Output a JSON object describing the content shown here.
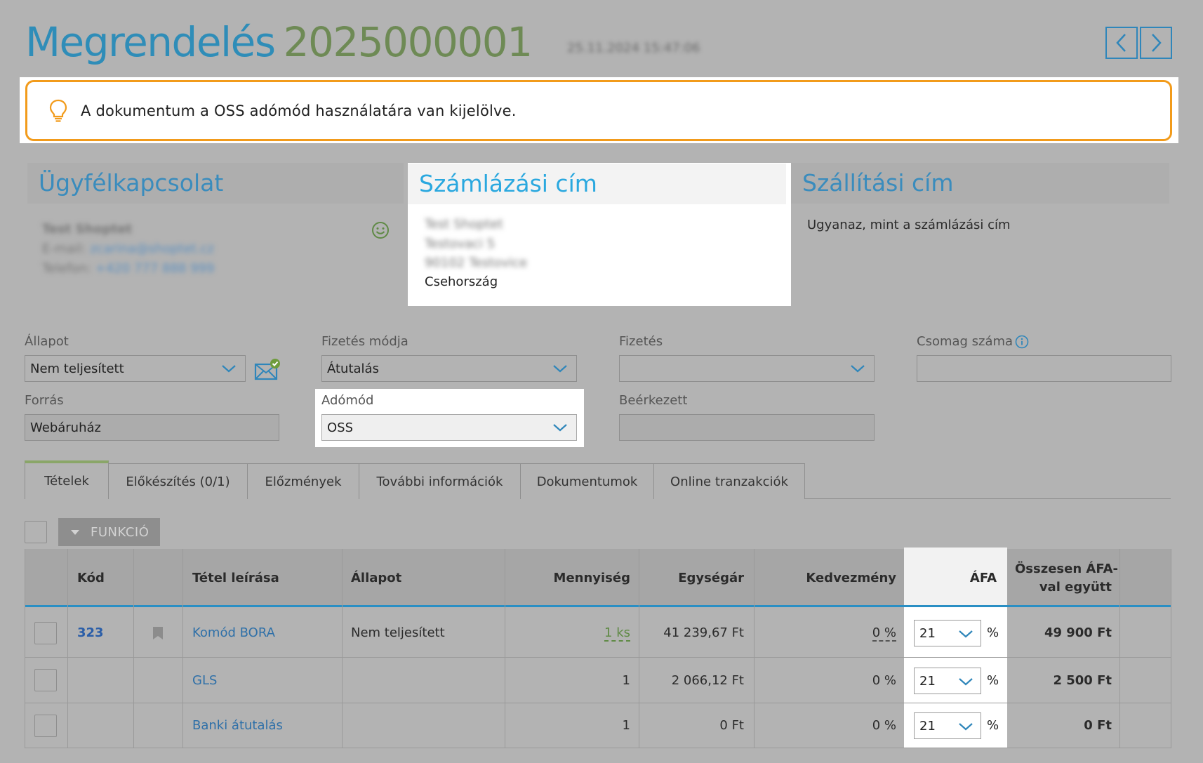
{
  "header": {
    "title_word": "Megrendelés",
    "title_number": "2025000001",
    "date_blurred": "25.11.2024 15:47:06"
  },
  "notice": {
    "message": "A dokumentum a OSS adómód használatára van kijelölve."
  },
  "customer": {
    "heading": "Ügyfélkapcsolat",
    "name_blurred": "Test Shoptet",
    "email_label": "E-mail:",
    "email_blurred": "zcarina@shoptet.cz",
    "phone_label": "Telefon:",
    "phone_blurred": "+420 777 888 999"
  },
  "billing": {
    "heading": "Számlázási cím",
    "line1_blurred": "Test Shoptet",
    "line2_blurred": "Testovaci 5",
    "line3_blurred": "90102 Testovice",
    "country": "Csehország"
  },
  "shipping": {
    "heading": "Szállítási cím",
    "same_as_billing": "Ugyanaz, mint a számlázási cím"
  },
  "form": {
    "status_label": "Állapot",
    "status_value": "Nem teljesített",
    "payment_method_label": "Fizetés módja",
    "payment_method_value": "Átutalás",
    "payment_label": "Fizetés",
    "payment_value": "",
    "package_label": "Csomag száma",
    "package_value": "",
    "source_label": "Forrás",
    "source_value": "Webáruház",
    "tax_mode_label": "Adómód",
    "tax_mode_value": "OSS",
    "received_label": "Beérkezett",
    "received_value": ""
  },
  "tabs": [
    {
      "label": "Tételek"
    },
    {
      "label": "Előkészítés (0/1)"
    },
    {
      "label": "Előzmények"
    },
    {
      "label": "További információk"
    },
    {
      "label": "Dokumentumok"
    },
    {
      "label": "Online tranzakciók"
    }
  ],
  "toolbar": {
    "function_label": "FUNKCIÓ"
  },
  "table": {
    "columns": {
      "code": "Kód",
      "description": "Tétel leírása",
      "status": "Állapot",
      "quantity": "Mennyiség",
      "unit_price": "Egységár",
      "discount": "Kedvezmény",
      "vat": "ÁFA",
      "total_line1": "Összesen ÁFA-",
      "total_line2": "val együtt"
    },
    "rows": [
      {
        "code": "323",
        "description": "Komód BORA",
        "status": "Nem teljesített",
        "quantity": "1 ks",
        "unit_price": "41 239,67 Ft",
        "discount": "0 %",
        "vat": "21",
        "vat_unit": "%",
        "total": "49 900 Ft"
      },
      {
        "code": "",
        "description": "GLS",
        "status": "",
        "quantity": "1",
        "unit_price": "2 066,12 Ft",
        "discount": "0 %",
        "vat": "21",
        "vat_unit": "%",
        "total": "2 500 Ft"
      },
      {
        "code": "",
        "description": "Banki átutalás",
        "status": "",
        "quantity": "1",
        "unit_price": "0 Ft",
        "discount": "0 %",
        "vat": "21",
        "vat_unit": "%",
        "total": "0 Ft"
      }
    ]
  },
  "colors": {
    "accent_blue": "#2f8db8",
    "number_green": "#6e8a55",
    "notice_orange": "#f29b1b",
    "table_header_line": "#2a8fc4"
  }
}
